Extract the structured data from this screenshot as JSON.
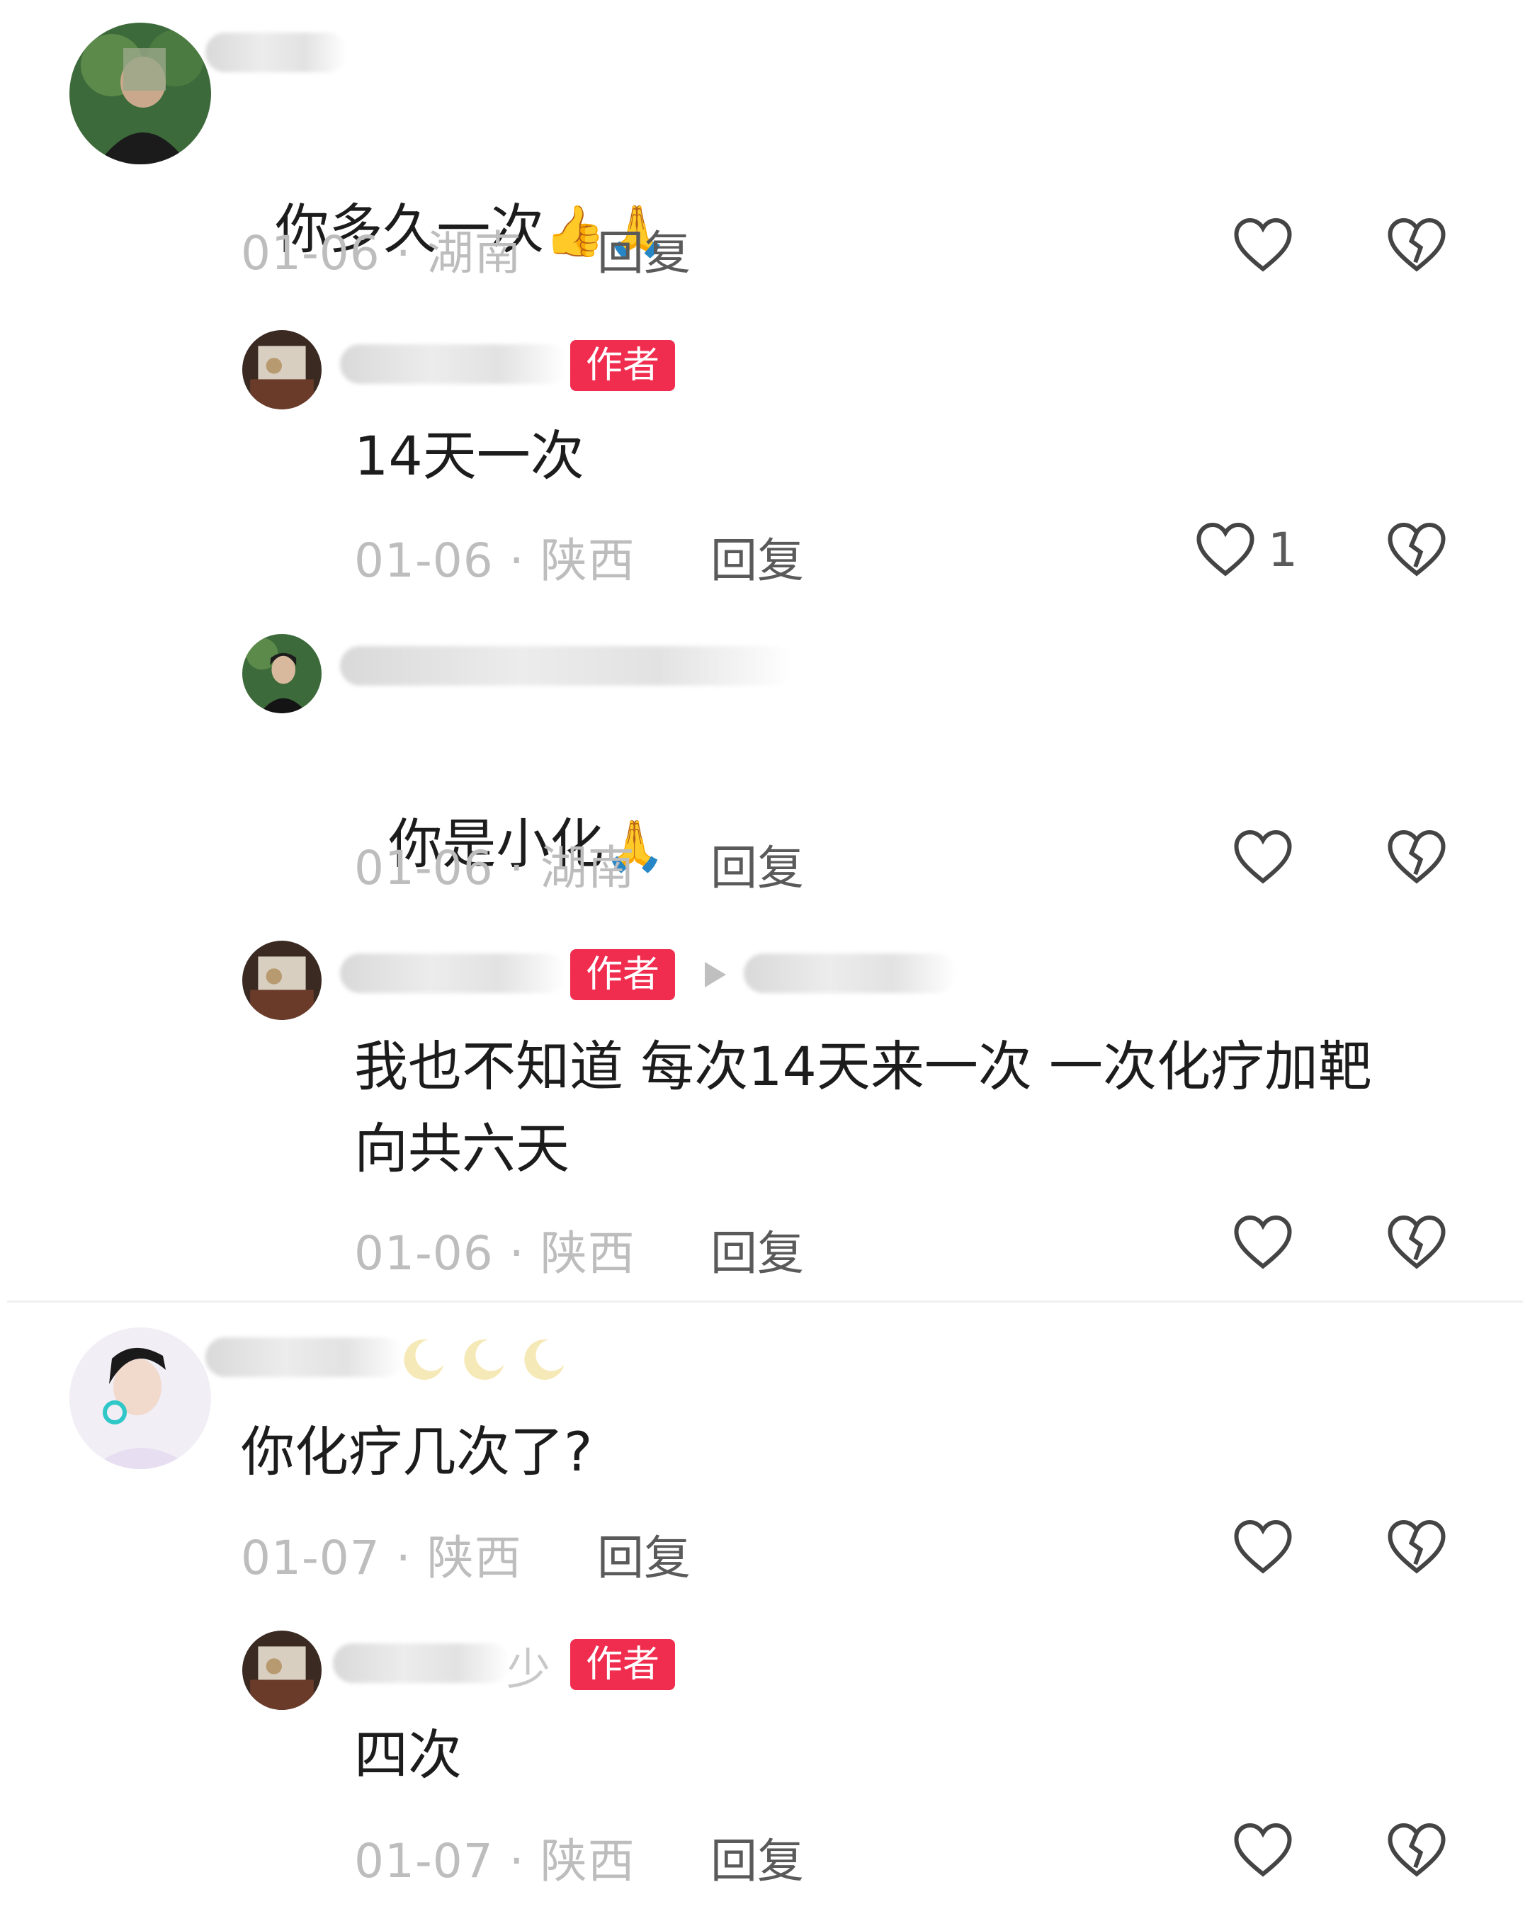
{
  "comments": [
    {
      "text": "你多久一次",
      "emoji": "👍🙏",
      "date": "01-06",
      "location": "湖南",
      "reply_label": "回复"
    },
    {
      "badge": "作者",
      "text": "14天一次",
      "date": "01-06",
      "location": "陕西",
      "reply_label": "回复",
      "like_count": "1"
    },
    {
      "text": "你是小化",
      "emoji": "🙏",
      "date": "01-06",
      "location": "湖南",
      "reply_label": "回复"
    },
    {
      "badge": "作者",
      "text": "我也不知道 每次14天来一次 一次化疗加靶\n向共六天",
      "date": "01-06",
      "location": "陕西",
      "reply_label": "回复"
    },
    {
      "text": "你化疗几次了?",
      "date": "01-07",
      "location": "陕西",
      "reply_label": "回复"
    },
    {
      "badge": "作者",
      "name_suffix": "少",
      "text": "四次",
      "date": "01-07",
      "location": "陕西",
      "reply_label": "回复"
    }
  ],
  "icons": {
    "like": "heart-outline-icon",
    "dislike": "broken-heart-icon"
  },
  "colors": {
    "badge": "#f02d4f",
    "meta": "#bdbdbd",
    "text": "#1c1c1c"
  }
}
